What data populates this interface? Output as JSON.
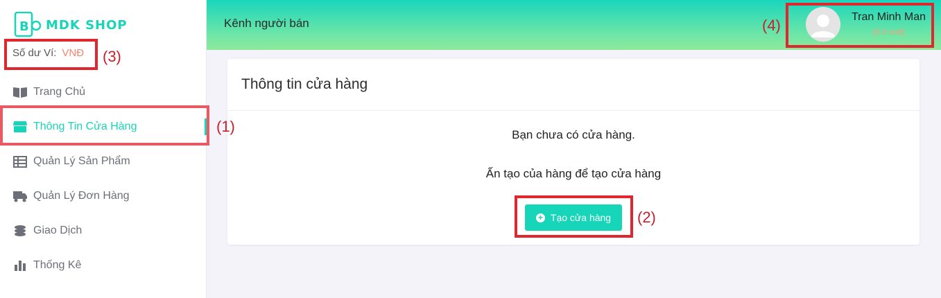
{
  "brand": {
    "logo_text": "BO",
    "name": "MDK SHOP"
  },
  "wallet": {
    "label": "Số dư Ví:",
    "currency": "VNĐ"
  },
  "sidebar": {
    "items": [
      {
        "label": "Trang Chủ",
        "icon": "book-icon"
      },
      {
        "label": "Thông Tin Cửa Hàng",
        "icon": "store-icon"
      },
      {
        "label": "Quản Lý Sản Phẩm",
        "icon": "table-icon"
      },
      {
        "label": "Quản Lý Đơn Hàng",
        "icon": "truck-icon"
      },
      {
        "label": "Giao Dịch",
        "icon": "coins-icon"
      },
      {
        "label": "Thống Kê",
        "icon": "bar-chart-icon"
      }
    ],
    "active_index": 1
  },
  "header": {
    "title": "Kênh người bán"
  },
  "user": {
    "name": "Tran Minh Man",
    "balance": "(0.0 vnđ)"
  },
  "card": {
    "title": "Thông tin cửa hàng",
    "message1": "Bạn chưa có cửa hàng.",
    "message2": "Ấn tạo của hàng để tạo cửa hàng",
    "create_button": "Tạo cửa hàng"
  },
  "annotations": [
    "(1)",
    "(2)",
    "(3)",
    "(4)"
  ],
  "colors": {
    "accent": "#17d5b8",
    "annotation": "#e0262f",
    "wallet_currency": "#f4866b"
  }
}
